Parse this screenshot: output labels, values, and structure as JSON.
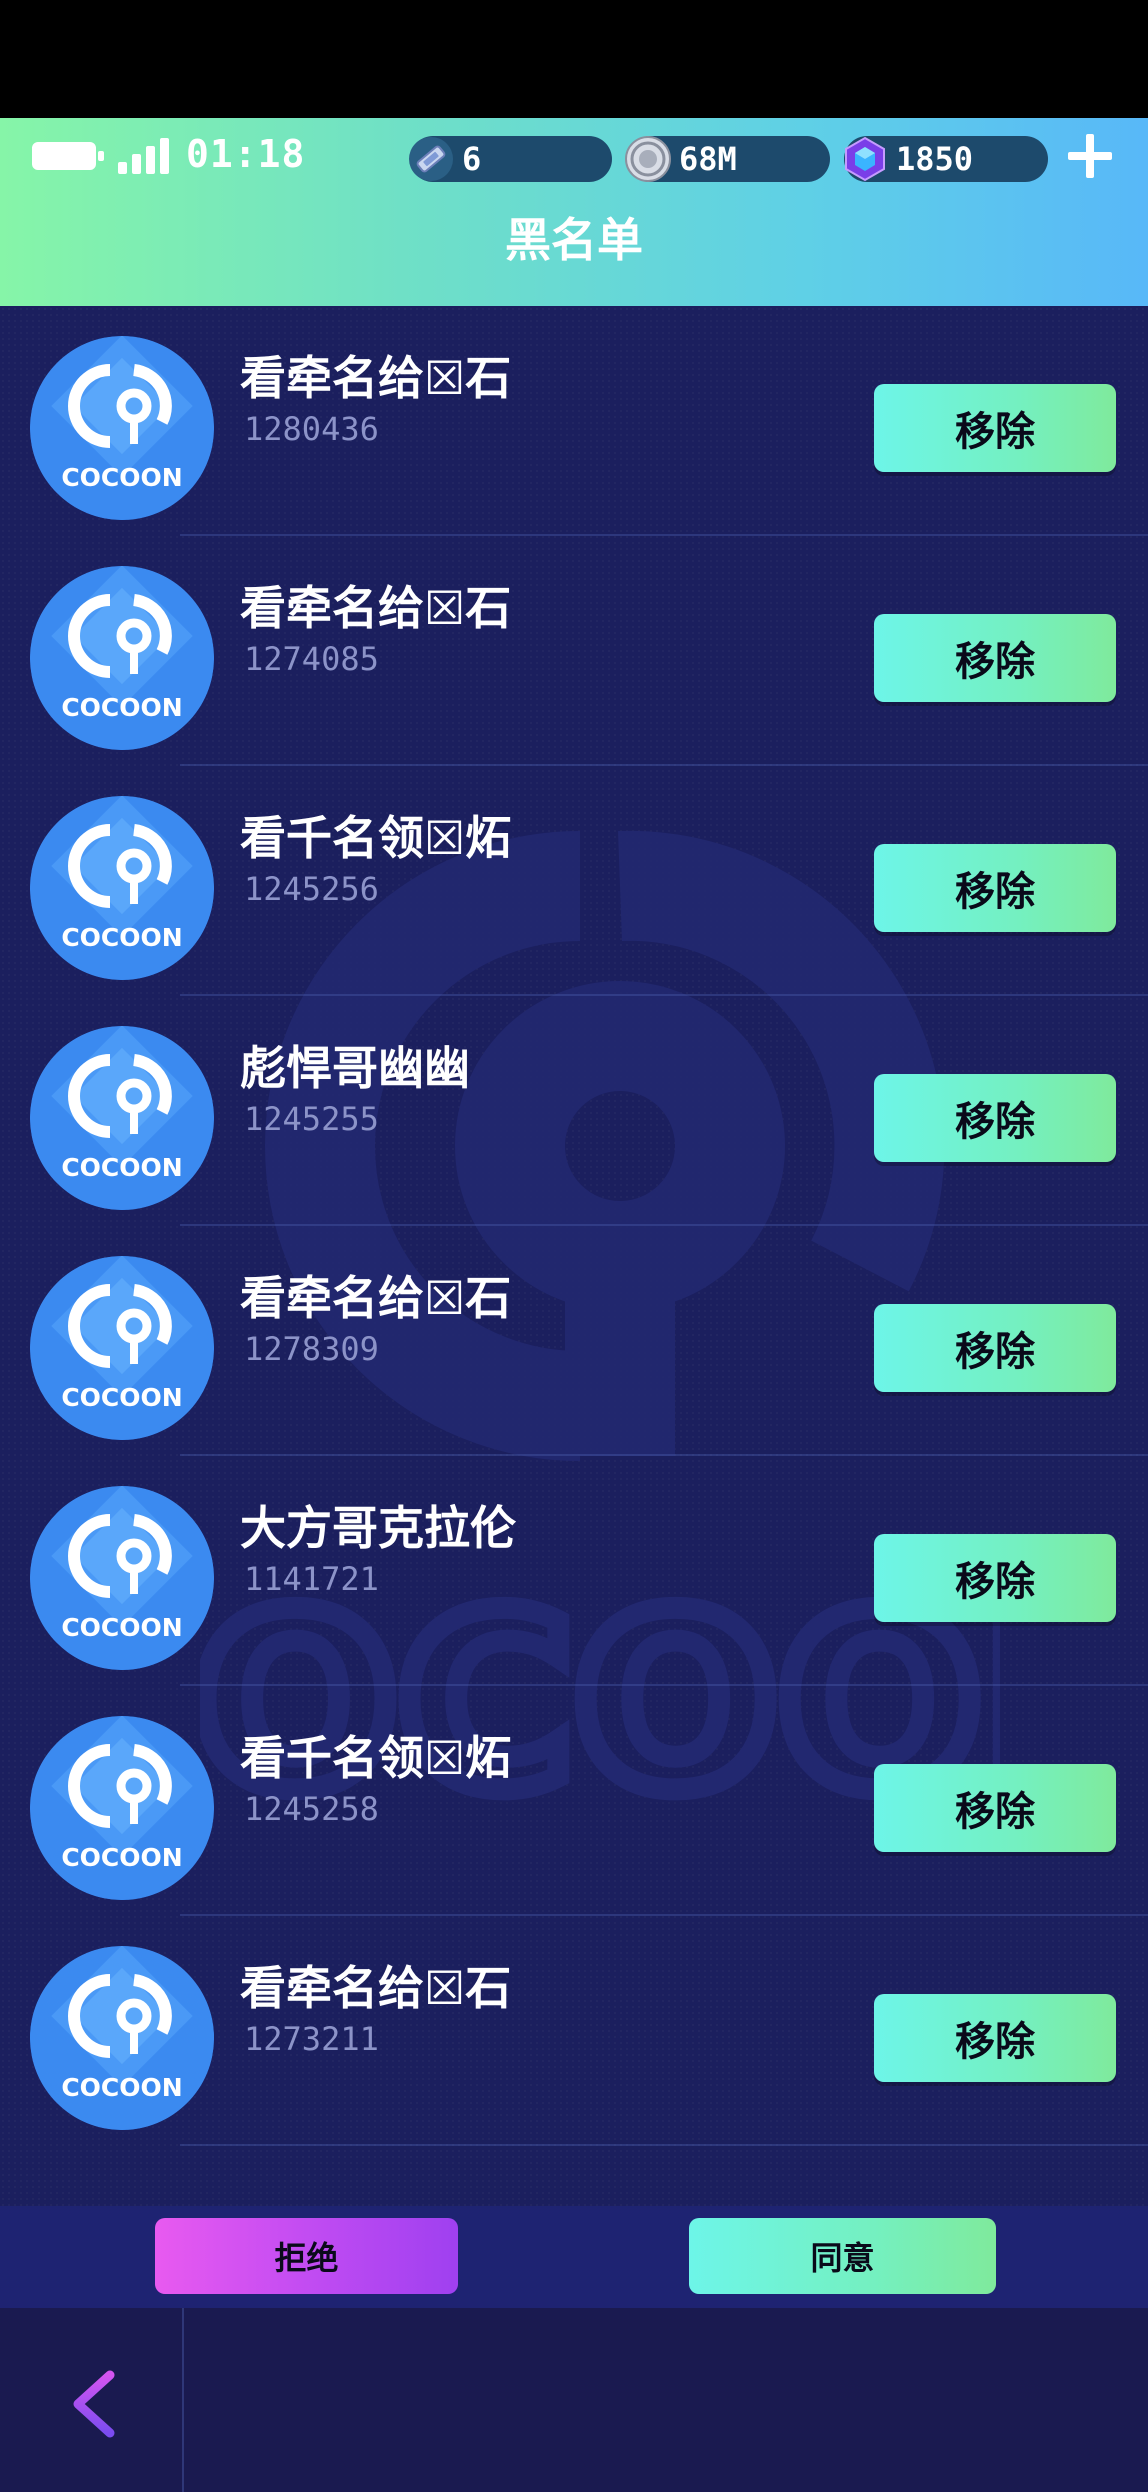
{
  "status": {
    "time": "01:18",
    "ticket_count": "6",
    "coin_count": "68M",
    "gem_count": "1850",
    "icons": [
      "battery-icon",
      "signal-icon",
      "ticket-icon",
      "coin-icon",
      "gem-icon",
      "plus-icon"
    ]
  },
  "header": {
    "title": "黑名单"
  },
  "avatar_label": "COCOON",
  "watermark_label": "COCOON",
  "blacklist": [
    {
      "name": "看牵名给☒石",
      "id": "1280436",
      "action": "移除"
    },
    {
      "name": "看牵名给☒石",
      "id": "1274085",
      "action": "移除"
    },
    {
      "name": "看千名领☒炻",
      "id": "1245256",
      "action": "移除"
    },
    {
      "name": "彪悍哥幽幽",
      "id": "1245255",
      "action": "移除"
    },
    {
      "name": "看牵名给☒石",
      "id": "1278309",
      "action": "移除"
    },
    {
      "name": "大方哥克拉伦",
      "id": "1141721",
      "action": "移除"
    },
    {
      "name": "看千名领☒炻",
      "id": "1245258",
      "action": "移除"
    },
    {
      "name": "看牵名给☒石",
      "id": "1273211",
      "action": "移除"
    }
  ],
  "actions": {
    "reject": "拒绝",
    "agree": "同意"
  },
  "nav": {
    "back_icon": "chevron-left-icon"
  },
  "colors": {
    "header_start": "#86f5a8",
    "header_end": "#58b8f8",
    "background": "#1b1f5e",
    "remove_button": "#74f0c0",
    "reject_button": "#c24cf2",
    "uid_text": "#8c93c8"
  }
}
